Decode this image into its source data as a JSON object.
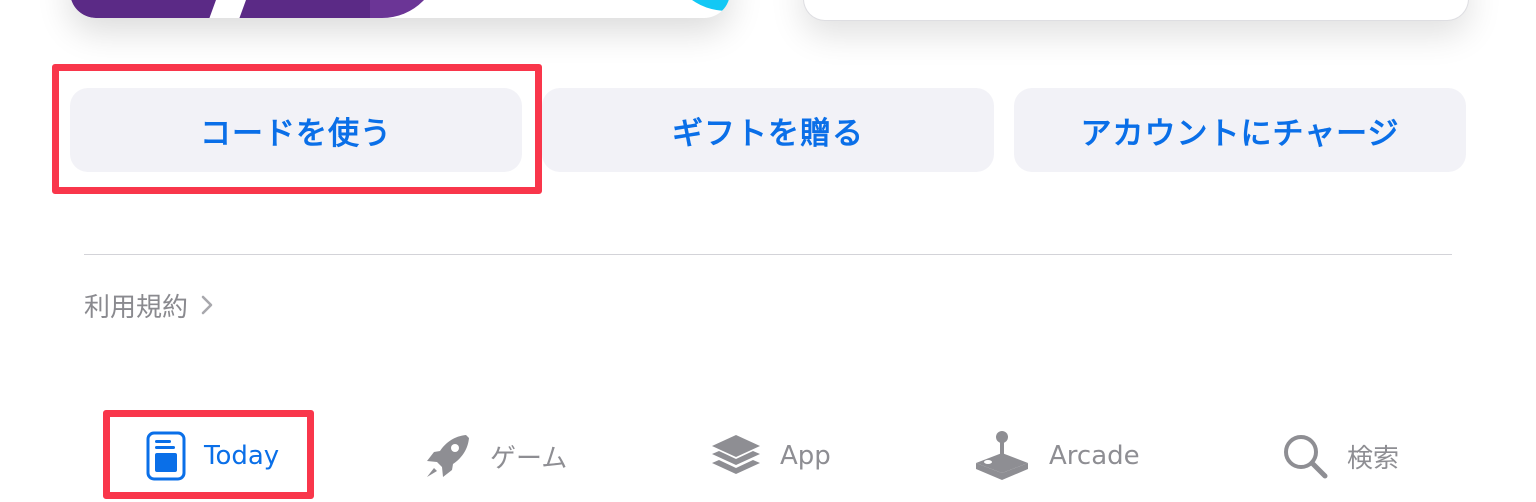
{
  "actions": {
    "redeem_code": "コードを使う",
    "send_gift": "ギフトを贈る",
    "add_funds": "アカウントにチャージ"
  },
  "footer": {
    "terms_label": "利用規約"
  },
  "tabbar": {
    "active": "today",
    "items": [
      {
        "id": "today",
        "label": "Today",
        "icon": "today-icon"
      },
      {
        "id": "games",
        "label": "ゲーム",
        "icon": "rocket-icon"
      },
      {
        "id": "apps",
        "label": "App",
        "icon": "layers-icon"
      },
      {
        "id": "arcade",
        "label": "Arcade",
        "icon": "joystick-icon"
      },
      {
        "id": "search",
        "label": "検索",
        "icon": "search-icon"
      }
    ]
  },
  "colors": {
    "accent": "#0a6fe8",
    "inactive": "#8e8e93",
    "highlight": "#f9364b",
    "button_bg": "#f2f2f7"
  }
}
